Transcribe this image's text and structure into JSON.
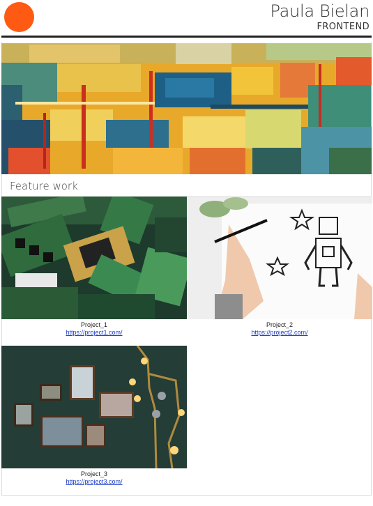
{
  "header": {
    "name": "Paula Bielan",
    "role": "FRONTEND",
    "logo_color": "#ff5a14"
  },
  "hero": {
    "image": "abstract-painting"
  },
  "featured": {
    "title": "Feature work",
    "projects": [
      {
        "title": "Project_1",
        "link": "https://project1.com/",
        "image": "circuit-boards-photo"
      },
      {
        "title": "Project_2",
        "link": "https://project2.com/",
        "image": "robot-sketch-photo"
      },
      {
        "title": "Project_3",
        "link": "https://project3.com/",
        "image": "frames-wall-photo"
      }
    ]
  },
  "colors": {
    "link": "#1a3cc8",
    "text": "#222222"
  }
}
